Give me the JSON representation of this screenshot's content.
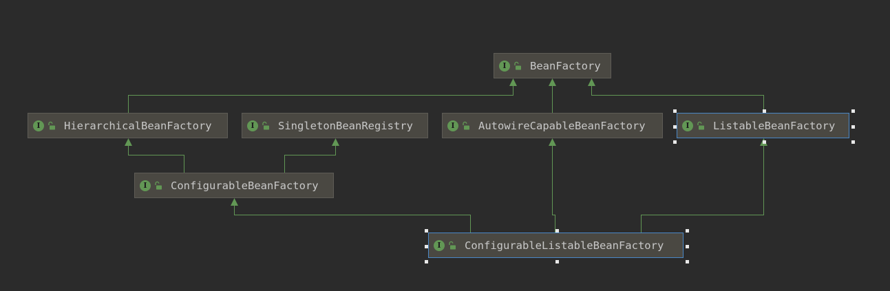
{
  "diagram": {
    "colors": {
      "background": "#2b2b2b",
      "node_fill": "#4a4842",
      "edge": "#629755",
      "selection": "#4a88c7",
      "text": "#c8c8c8"
    },
    "node_icon": {
      "letter": "I",
      "name": "interface-icon",
      "secondary": "public-access-icon"
    },
    "nodes": [
      {
        "id": "bean-factory",
        "label": "BeanFactory",
        "selected": false
      },
      {
        "id": "hierarchical-bean-factory",
        "label": "HierarchicalBeanFactory",
        "selected": false
      },
      {
        "id": "singleton-bean-registry",
        "label": "SingletonBeanRegistry",
        "selected": false
      },
      {
        "id": "autowire-capable-bean-factory",
        "label": "AutowireCapableBeanFactory",
        "selected": false
      },
      {
        "id": "listable-bean-factory",
        "label": "ListableBeanFactory",
        "selected": true
      },
      {
        "id": "configurable-bean-factory",
        "label": "ConfigurableBeanFactory",
        "selected": false
      },
      {
        "id": "configurable-listable-bean-factory",
        "label": "ConfigurableListableBeanFactory",
        "selected": true
      }
    ],
    "edges": [
      {
        "from": "hierarchical-bean-factory",
        "to": "bean-factory"
      },
      {
        "from": "autowire-capable-bean-factory",
        "to": "bean-factory"
      },
      {
        "from": "listable-bean-factory",
        "to": "bean-factory"
      },
      {
        "from": "configurable-bean-factory",
        "to": "hierarchical-bean-factory"
      },
      {
        "from": "configurable-bean-factory",
        "to": "singleton-bean-registry"
      },
      {
        "from": "configurable-listable-bean-factory",
        "to": "configurable-bean-factory"
      },
      {
        "from": "configurable-listable-bean-factory",
        "to": "autowire-capable-bean-factory"
      },
      {
        "from": "configurable-listable-bean-factory",
        "to": "listable-bean-factory"
      }
    ]
  }
}
